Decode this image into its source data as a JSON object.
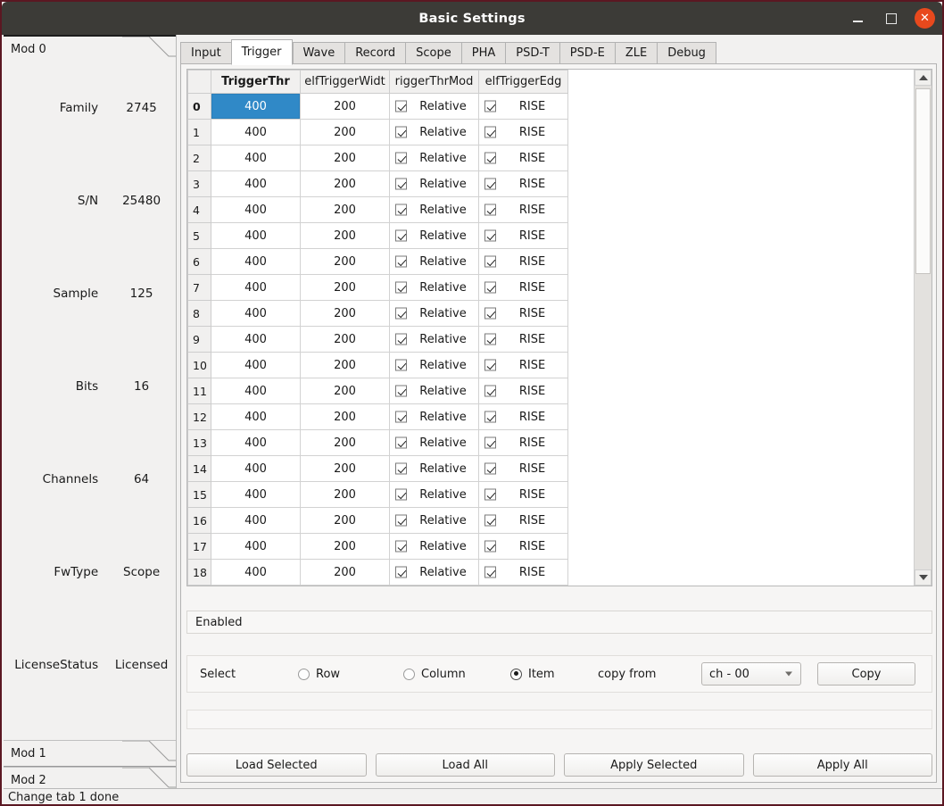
{
  "window": {
    "title": "Basic Settings",
    "minimize_label": "–",
    "maximize_label": "□",
    "close_label": "✕",
    "accent_close": "#e8491d",
    "titlebar_color": "#3c3b37",
    "border_color": "#5b1722"
  },
  "sidebar": {
    "sections": [
      {
        "label": "Mod 0",
        "open": true
      },
      {
        "label": "Mod 1",
        "open": false
      },
      {
        "label": "Mod 2",
        "open": false
      }
    ],
    "info": [
      {
        "label": "Family",
        "value": "2745"
      },
      {
        "label": "S/N",
        "value": "25480"
      },
      {
        "label": "Sample",
        "value": "125"
      },
      {
        "label": "Bits",
        "value": "16"
      },
      {
        "label": "Channels",
        "value": "64"
      },
      {
        "label": "FwType",
        "value": "Scope"
      },
      {
        "label": "LicenseStatus",
        "value": "Licensed"
      }
    ]
  },
  "tabs": [
    {
      "label": "Input",
      "active": false
    },
    {
      "label": "Trigger",
      "active": true
    },
    {
      "label": "Wave",
      "active": false
    },
    {
      "label": "Record",
      "active": false
    },
    {
      "label": "Scope",
      "active": false
    },
    {
      "label": "PHA",
      "active": false
    },
    {
      "label": "PSD-T",
      "active": false
    },
    {
      "label": "PSD-E",
      "active": false
    },
    {
      "label": "ZLE",
      "active": false
    },
    {
      "label": "Debug",
      "active": false
    }
  ],
  "table": {
    "corner_header": "",
    "columns": [
      {
        "header": "TriggerThr",
        "type": "num",
        "selected": true
      },
      {
        "header": "elfTriggerWidt",
        "type": "num",
        "selected": false
      },
      {
        "header": "riggerThrMod",
        "type": "check",
        "selected": false
      },
      {
        "header": "elfTriggerEdg",
        "type": "check",
        "selected": false
      }
    ],
    "selected_cell": {
      "row": 0,
      "col": 0
    },
    "rows": [
      {
        "id": "0",
        "TriggerThr": "400",
        "elfTriggerWidt": "200",
        "riggerThrMod": "Relative",
        "riggerThrMod_checked": true,
        "elfTriggerEdg": "RISE",
        "elfTriggerEdg_checked": true
      },
      {
        "id": "1",
        "TriggerThr": "400",
        "elfTriggerWidt": "200",
        "riggerThrMod": "Relative",
        "riggerThrMod_checked": true,
        "elfTriggerEdg": "RISE",
        "elfTriggerEdg_checked": true
      },
      {
        "id": "2",
        "TriggerThr": "400",
        "elfTriggerWidt": "200",
        "riggerThrMod": "Relative",
        "riggerThrMod_checked": true,
        "elfTriggerEdg": "RISE",
        "elfTriggerEdg_checked": true
      },
      {
        "id": "3",
        "TriggerThr": "400",
        "elfTriggerWidt": "200",
        "riggerThrMod": "Relative",
        "riggerThrMod_checked": true,
        "elfTriggerEdg": "RISE",
        "elfTriggerEdg_checked": true
      },
      {
        "id": "4",
        "TriggerThr": "400",
        "elfTriggerWidt": "200",
        "riggerThrMod": "Relative",
        "riggerThrMod_checked": true,
        "elfTriggerEdg": "RISE",
        "elfTriggerEdg_checked": true
      },
      {
        "id": "5",
        "TriggerThr": "400",
        "elfTriggerWidt": "200",
        "riggerThrMod": "Relative",
        "riggerThrMod_checked": true,
        "elfTriggerEdg": "RISE",
        "elfTriggerEdg_checked": true
      },
      {
        "id": "6",
        "TriggerThr": "400",
        "elfTriggerWidt": "200",
        "riggerThrMod": "Relative",
        "riggerThrMod_checked": true,
        "elfTriggerEdg": "RISE",
        "elfTriggerEdg_checked": true
      },
      {
        "id": "7",
        "TriggerThr": "400",
        "elfTriggerWidt": "200",
        "riggerThrMod": "Relative",
        "riggerThrMod_checked": true,
        "elfTriggerEdg": "RISE",
        "elfTriggerEdg_checked": true
      },
      {
        "id": "8",
        "TriggerThr": "400",
        "elfTriggerWidt": "200",
        "riggerThrMod": "Relative",
        "riggerThrMod_checked": true,
        "elfTriggerEdg": "RISE",
        "elfTriggerEdg_checked": true
      },
      {
        "id": "9",
        "TriggerThr": "400",
        "elfTriggerWidt": "200",
        "riggerThrMod": "Relative",
        "riggerThrMod_checked": true,
        "elfTriggerEdg": "RISE",
        "elfTriggerEdg_checked": true
      },
      {
        "id": "10",
        "TriggerThr": "400",
        "elfTriggerWidt": "200",
        "riggerThrMod": "Relative",
        "riggerThrMod_checked": true,
        "elfTriggerEdg": "RISE",
        "elfTriggerEdg_checked": true
      },
      {
        "id": "11",
        "TriggerThr": "400",
        "elfTriggerWidt": "200",
        "riggerThrMod": "Relative",
        "riggerThrMod_checked": true,
        "elfTriggerEdg": "RISE",
        "elfTriggerEdg_checked": true
      },
      {
        "id": "12",
        "TriggerThr": "400",
        "elfTriggerWidt": "200",
        "riggerThrMod": "Relative",
        "riggerThrMod_checked": true,
        "elfTriggerEdg": "RISE",
        "elfTriggerEdg_checked": true
      },
      {
        "id": "13",
        "TriggerThr": "400",
        "elfTriggerWidt": "200",
        "riggerThrMod": "Relative",
        "riggerThrMod_checked": true,
        "elfTriggerEdg": "RISE",
        "elfTriggerEdg_checked": true
      },
      {
        "id": "14",
        "TriggerThr": "400",
        "elfTriggerWidt": "200",
        "riggerThrMod": "Relative",
        "riggerThrMod_checked": true,
        "elfTriggerEdg": "RISE",
        "elfTriggerEdg_checked": true
      },
      {
        "id": "15",
        "TriggerThr": "400",
        "elfTriggerWidt": "200",
        "riggerThrMod": "Relative",
        "riggerThrMod_checked": true,
        "elfTriggerEdg": "RISE",
        "elfTriggerEdg_checked": true
      },
      {
        "id": "16",
        "TriggerThr": "400",
        "elfTriggerWidt": "200",
        "riggerThrMod": "Relative",
        "riggerThrMod_checked": true,
        "elfTriggerEdg": "RISE",
        "elfTriggerEdg_checked": true
      },
      {
        "id": "17",
        "TriggerThr": "400",
        "elfTriggerWidt": "200",
        "riggerThrMod": "Relative",
        "riggerThrMod_checked": true,
        "elfTriggerEdg": "RISE",
        "elfTriggerEdg_checked": true
      },
      {
        "id": "18",
        "TriggerThr": "400",
        "elfTriggerWidt": "200",
        "riggerThrMod": "Relative",
        "riggerThrMod_checked": true,
        "elfTriggerEdg": "RISE",
        "elfTriggerEdg_checked": true
      }
    ]
  },
  "enabled_bar": {
    "label": "Enabled"
  },
  "select_bar": {
    "label": "Select",
    "options": [
      {
        "label": "Row",
        "checked": false
      },
      {
        "label": "Column",
        "checked": false
      },
      {
        "label": "Item",
        "checked": true
      }
    ],
    "copy_from_label": "copy from",
    "channel_value": "ch - 00",
    "copy_button": "Copy"
  },
  "bottom_buttons": [
    {
      "label": "Load Selected"
    },
    {
      "label": "Load All"
    },
    {
      "label": "Apply Selected"
    },
    {
      "label": "Apply All"
    }
  ],
  "statusbar": {
    "text": "Change tab 1 done"
  },
  "colors": {
    "selection_blue": "#3089c7",
    "panel_bg": "#f2f1f0",
    "table_bg": "#ffffff"
  }
}
